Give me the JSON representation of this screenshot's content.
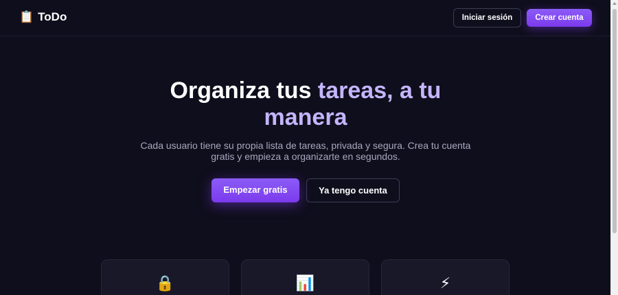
{
  "header": {
    "brand_icon": "📋",
    "brand_name": "ToDo",
    "login_label": "Iniciar sesión",
    "register_label": "Crear cuenta"
  },
  "hero": {
    "title_plain": "Organiza tus ",
    "title_accent": "tareas, a tu manera",
    "subtitle": "Cada usuario tiene su propia lista de tareas, privada y segura. Crea tu cuenta gratis y empieza a organizarte en segundos.",
    "primary_cta": "Empezar gratis",
    "secondary_cta": "Ya tengo cuenta"
  },
  "features": [
    {
      "icon": "🔒",
      "icon_name": "lock-icon"
    },
    {
      "icon": "📊",
      "icon_name": "bar-chart-icon"
    },
    {
      "icon": "⚡",
      "icon_name": "lightning-icon"
    }
  ],
  "colors": {
    "background": "#0f0e1c",
    "accent": "#7c3aed",
    "accent_text": "#c4b5fd",
    "muted_text": "#a9a8bf",
    "card": "#191829"
  }
}
